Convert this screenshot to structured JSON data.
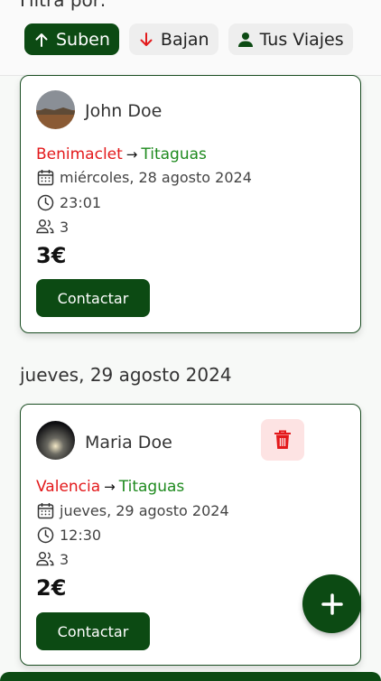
{
  "filter": {
    "label": "Filtra por:",
    "chips": [
      {
        "label": "Suben",
        "icon": "arrow-up-icon",
        "active": true
      },
      {
        "label": "Bajan",
        "icon": "arrow-down-icon",
        "active": false
      },
      {
        "label": "Tus Viajes",
        "icon": "person-icon",
        "active": false
      }
    ]
  },
  "trips": [
    {
      "driver": "John Doe",
      "from": "Benimaclet",
      "arrow": "→",
      "to": "Titaguas",
      "date": "miércoles, 28 agosto 2024",
      "time": "23:01",
      "seats": "3",
      "price": "3€",
      "contact_label": "Contactar"
    },
    {
      "date_heading": "jueves, 29 agosto 2024",
      "driver": "Maria Doe",
      "from": "Valencia",
      "arrow": "→",
      "to": "Titaguas",
      "date": "jueves, 29 agosto 2024",
      "time": "12:30",
      "seats": "3",
      "price": "2€",
      "contact_label": "Contactar",
      "delete_icon": "trash-icon"
    }
  ],
  "fab": {
    "icon": "plus-icon"
  },
  "colors": {
    "primary": "#0c4a13",
    "origin": "#e3191b",
    "destination": "#1e8a1e",
    "delete_bg": "#fde3e3",
    "delete_icon": "#e3191b"
  }
}
